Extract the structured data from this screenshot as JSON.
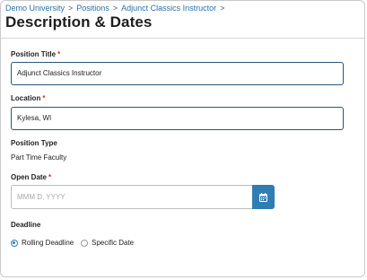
{
  "breadcrumb": {
    "items": [
      "Demo University",
      "Positions",
      "Adjunct Classics Instructor"
    ],
    "separator": ">"
  },
  "page": {
    "title": "Description & Dates"
  },
  "form": {
    "required_marker": "*",
    "position_title": {
      "label": "Position Title",
      "value": "Adjunct Classics Instructor"
    },
    "location": {
      "label": "Location",
      "value": "Kylesa, WI"
    },
    "position_type": {
      "label": "Position Type",
      "value": "Part Time Faculty"
    },
    "open_date": {
      "label": "Open Date",
      "placeholder": "MMM D, YYYY",
      "button_icon": "calendar-icon"
    },
    "deadline": {
      "label": "Deadline",
      "options": [
        {
          "label": "Rolling Deadline",
          "selected": true
        },
        {
          "label": "Specific Date",
          "selected": false
        }
      ]
    }
  },
  "colors": {
    "link": "#2b6fa8",
    "accent": "#2f7db3",
    "input_border": "#2a5675",
    "required": "#c0392b"
  }
}
